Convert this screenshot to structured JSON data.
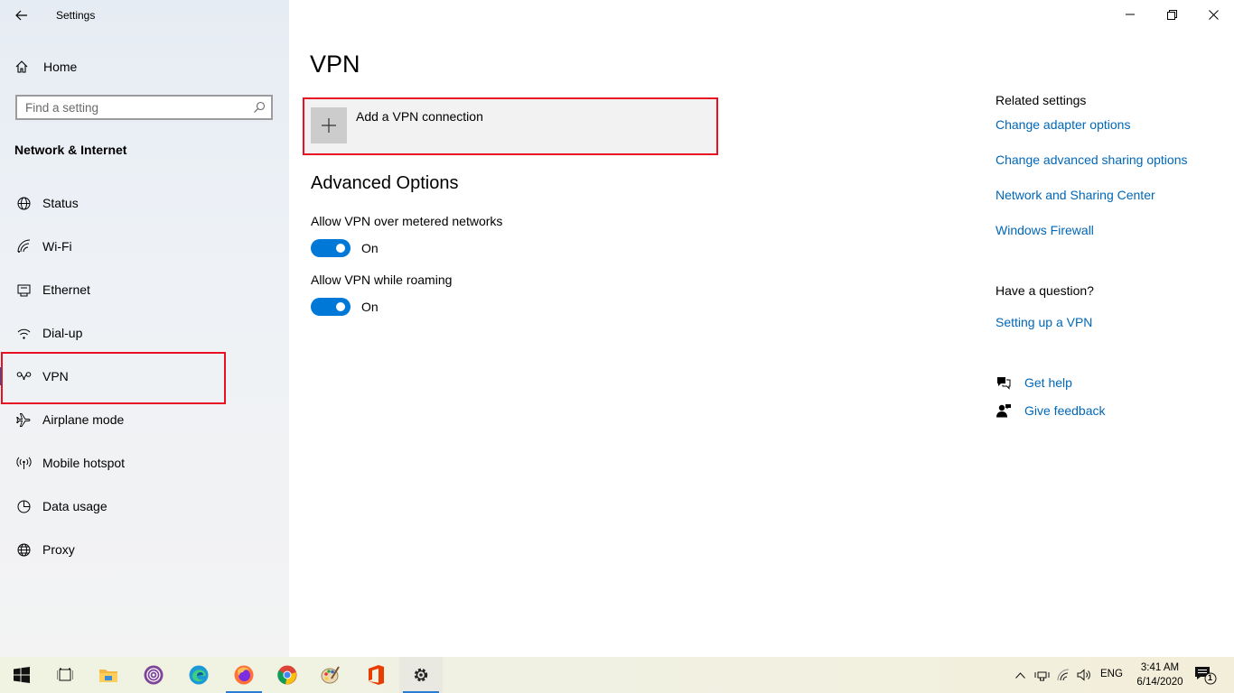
{
  "window": {
    "title": "Settings"
  },
  "sidebar": {
    "home_label": "Home",
    "search": {
      "placeholder": "Find a setting",
      "value": ""
    },
    "section_title": "Network & Internet",
    "items": [
      {
        "label": "Status",
        "icon": "globe-status-icon"
      },
      {
        "label": "Wi-Fi",
        "icon": "wifi-icon"
      },
      {
        "label": "Ethernet",
        "icon": "ethernet-icon"
      },
      {
        "label": "Dial-up",
        "icon": "dial-up-icon"
      },
      {
        "label": "VPN",
        "icon": "vpn-icon",
        "selected": true
      },
      {
        "label": "Airplane mode",
        "icon": "airplane-icon"
      },
      {
        "label": "Mobile hotspot",
        "icon": "hotspot-icon"
      },
      {
        "label": "Data usage",
        "icon": "data-usage-icon"
      },
      {
        "label": "Proxy",
        "icon": "globe-icon"
      }
    ]
  },
  "main": {
    "title": "VPN",
    "add_vpn_label": "Add a VPN connection",
    "advanced_title": "Advanced Options",
    "options": [
      {
        "label": "Allow VPN over metered networks",
        "state": "On"
      },
      {
        "label": "Allow VPN while roaming",
        "state": "On"
      }
    ]
  },
  "related": {
    "heading": "Related settings",
    "links": [
      "Change adapter options",
      "Change advanced sharing options",
      "Network and Sharing Center",
      "Windows Firewall"
    ],
    "question_heading": "Have a question?",
    "question_link": "Setting up a VPN",
    "get_help": "Get help",
    "give_feedback": "Give feedback"
  },
  "taskbar": {
    "apps": [
      "start-icon",
      "task-view-icon",
      "file-explorer-icon",
      "tor-browser-icon",
      "edge-icon",
      "firefox-icon",
      "chrome-icon",
      "paint-icon",
      "office-icon",
      "settings-gear-icon"
    ],
    "language": "ENG",
    "time": "3:41 AM",
    "date": "6/14/2020",
    "notification_count": "1"
  },
  "colors": {
    "accent": "#0078d7",
    "link": "#0067b8",
    "highlight": "#e81123",
    "sidebar_bg": "#edf1f6"
  }
}
